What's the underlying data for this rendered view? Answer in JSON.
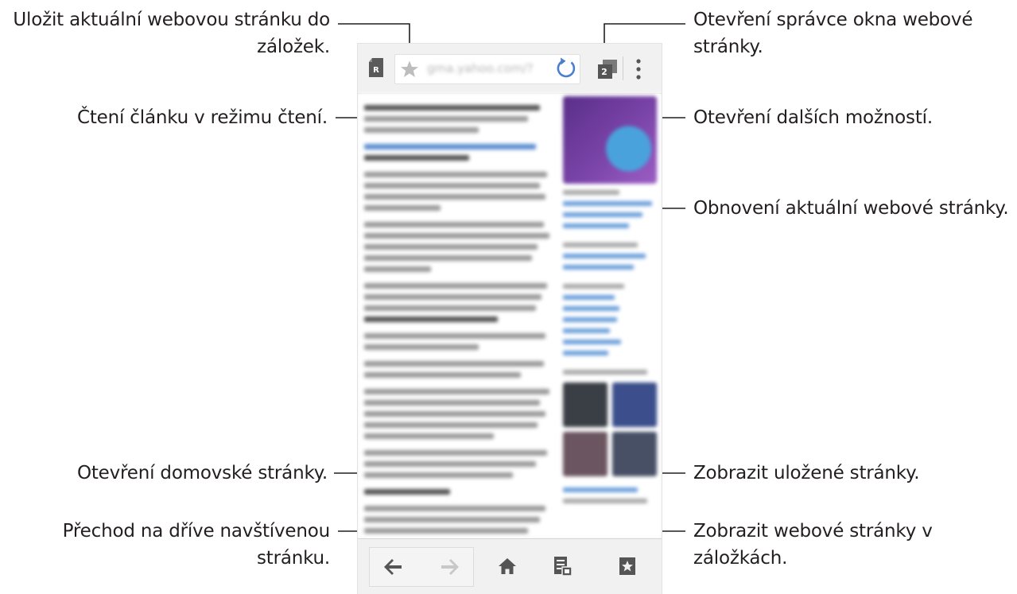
{
  "callouts": {
    "bookmark_save": {
      "line1": "Uložit aktuální webovou stránku do",
      "line2": "záložek."
    },
    "reader_mode": {
      "line1": "Čtení článku v režimu čtení."
    },
    "window_manager": {
      "line1": "Otevření správce okna webové",
      "line2": "stránky."
    },
    "more_options": {
      "line1": "Otevření dalších možností."
    },
    "refresh": {
      "line1": "Obnovení aktuální webové stránky."
    },
    "home": {
      "line1": "Otevření domovské stránky."
    },
    "saved_pages": {
      "line1": "Zobrazit uložené stránky."
    },
    "history_nav": {
      "line1": "Přechod na dříve navštívenou",
      "line2": "stránku."
    },
    "bookmarks": {
      "line1": "Zobrazit webové stránky v",
      "line2": "záložkách."
    }
  },
  "browser": {
    "url": "gma.yahoo.com/?",
    "window_count": "2",
    "icons": {
      "reader": "reader-mode-icon",
      "star": "star-icon",
      "refresh": "refresh-icon",
      "windows": "window-manager-icon",
      "more": "more-options-icon",
      "back": "back-arrow-icon",
      "forward": "forward-arrow-icon",
      "home": "home-icon",
      "saved": "saved-pages-icon",
      "bookmarks": "bookmarks-icon"
    },
    "colors": {
      "accent_refresh": "#4a7fd0",
      "icon_dark": "#555555",
      "icon_disabled": "#c8c8c8"
    }
  }
}
